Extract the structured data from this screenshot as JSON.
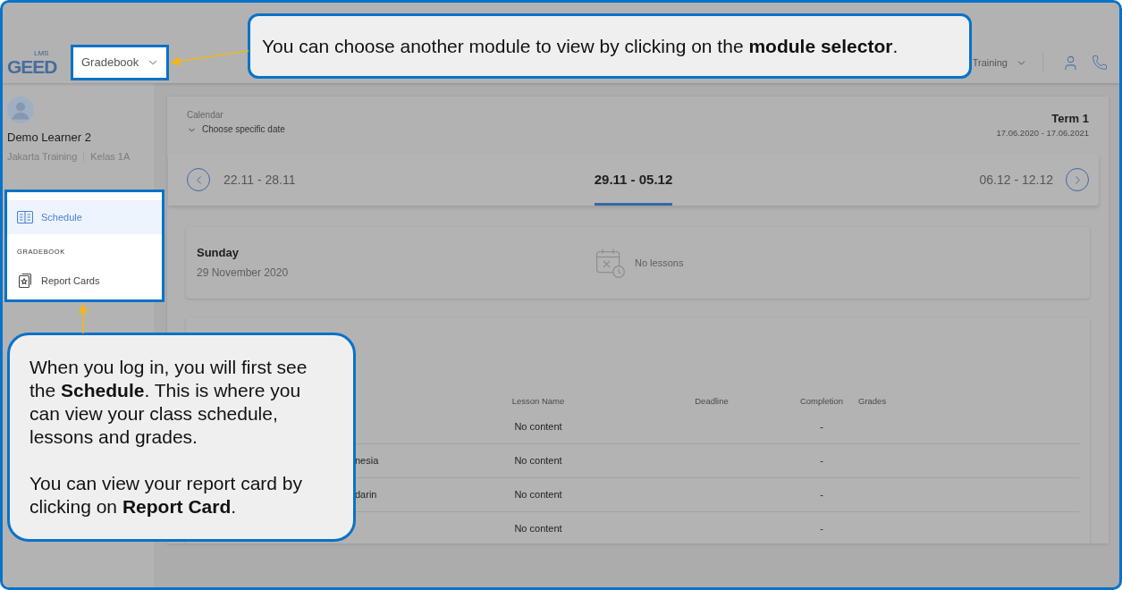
{
  "header": {
    "logo": {
      "badge": "LMS",
      "name": "GEED"
    },
    "module_selector": {
      "value": "Gradebook",
      "highlighted": true
    },
    "account_selector": {
      "value": "Training"
    }
  },
  "sidebar": {
    "user": {
      "name": "Demo Learner 2",
      "school": "Jakarta Training",
      "class": "Kelas 1A"
    },
    "menu": {
      "highlighted": true,
      "items": [
        {
          "label": "Schedule",
          "selected": true
        }
      ],
      "sections": [
        {
          "title": "GRADEBOOK",
          "items": [
            {
              "label": "Report Cards",
              "selected": false
            }
          ]
        }
      ]
    }
  },
  "calendar": {
    "label": "Calendar",
    "date_picker": "Choose specific date",
    "term": {
      "name": "Term 1",
      "dates": "17.06.2020 - 17.06.2021"
    },
    "weeks": [
      {
        "label": "22.11 - 28.11",
        "selected": false
      },
      {
        "label": "29.11 - 05.12",
        "selected": true
      },
      {
        "label": "06.12 - 12.12",
        "selected": false
      }
    ],
    "days": [
      {
        "day": "Sunday",
        "date": "29 November 2020",
        "status": "No lessons"
      }
    ]
  },
  "lessons_table": {
    "columns": [
      "Lesson Name",
      "Deadline",
      "Completion",
      "Grades"
    ],
    "rows": [
      {
        "lesson_name": "No content",
        "completion": "-"
      },
      {
        "column_1": "nesia",
        "lesson_name": "No content",
        "completion": "-"
      },
      {
        "column_1": "darin",
        "lesson_name": "No content",
        "completion": "-"
      },
      {
        "lesson_name": "No content",
        "completion": "-"
      }
    ]
  },
  "tour": {
    "module_tip": {
      "text": "You can choose another module to view by clicking on the **module selector**."
    },
    "menu_tip": {
      "paragraphs": [
        "When you log in, you will first see the **Schedule**. This is where you can view your class schedule, lessons and grades.",
        "You can view your report card by clicking on **Report Card**."
      ]
    }
  }
}
